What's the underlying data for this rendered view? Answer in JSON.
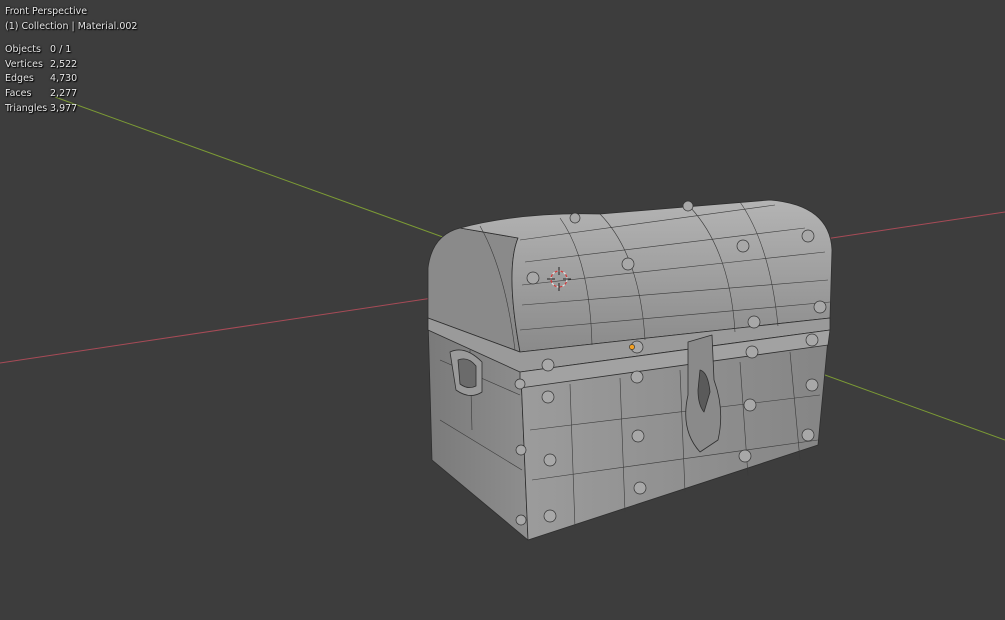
{
  "viewport": {
    "view_label": "Front Perspective",
    "collection_label": "(1) Collection | Material.002",
    "background_color": "#3d3d3d",
    "x_axis_color": "#a84b57",
    "y_axis_color": "#7c9b35"
  },
  "stats": {
    "objects": {
      "label": "Objects",
      "value": "0 / 1"
    },
    "vertices": {
      "label": "Vertices",
      "value": "2,522"
    },
    "edges": {
      "label": "Edges",
      "value": "4,730"
    },
    "faces": {
      "label": "Faces",
      "value": "2,277"
    },
    "triangles": {
      "label": "Triangles",
      "value": "3,977"
    }
  },
  "scene": {
    "object": "treasure-chest-mesh",
    "shading": "solid wireframe",
    "mesh_color": "#8e8e8e",
    "cursor": "3d-cursor-icon",
    "origin": "object-origin-icon",
    "origin_color": "#f2a024"
  }
}
